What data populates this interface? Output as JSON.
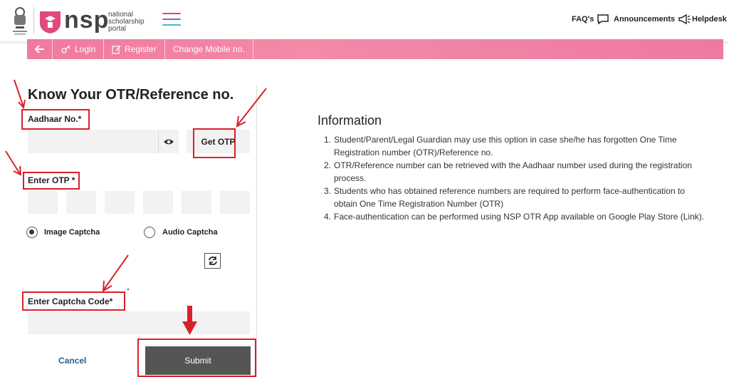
{
  "header": {
    "brand": "nsp",
    "brand_sub_1": "national",
    "brand_sub_2": "scholarship",
    "brand_sub_3": "portal",
    "nav": {
      "faqs": "FAQ's",
      "announcements": "Announcements",
      "helpdesk": "Helpdesk"
    }
  },
  "subnav": {
    "login": "Login",
    "register": "Register",
    "change_mobile": "Change Mobile no."
  },
  "form": {
    "title": "Know Your OTR/Reference no.",
    "aadhaar_label": "Aadhaar No.*",
    "aadhaar_value": "",
    "get_otp": "Get OTP",
    "otp_label": "Enter OTP *",
    "captcha_options": [
      "Image Captcha",
      "Audio Captcha"
    ],
    "selected_captcha": "Image Captcha",
    "captcha_code_label": "Enter Captcha Code*",
    "captcha_code_value": "",
    "cancel": "Cancel",
    "submit": "Submit"
  },
  "info": {
    "title": "Information",
    "items": [
      {
        "num": "1.",
        "text": "Student/Parent/Legal Guardian may use this option in case she/he has forgotten One Time Registration number (OTR)/Reference no."
      },
      {
        "num": "2.",
        "text": "OTR/Reference number can be retrieved with the Aadhaar number used during the registration process."
      },
      {
        "num": "3.",
        "text": "Students who has obtained reference numbers are required to perform face-authentication to obtain One Time Registration Number (OTR)"
      },
      {
        "num": "4.",
        "text": "Face-authentication can be performed using NSP OTR App available on Google Play Store (Link)."
      }
    ]
  },
  "colors": {
    "accent_pink": "#f07a9e",
    "annotation_red": "#d9202a",
    "submit_bg": "#555555",
    "cancel_text": "#2b5f8a"
  }
}
